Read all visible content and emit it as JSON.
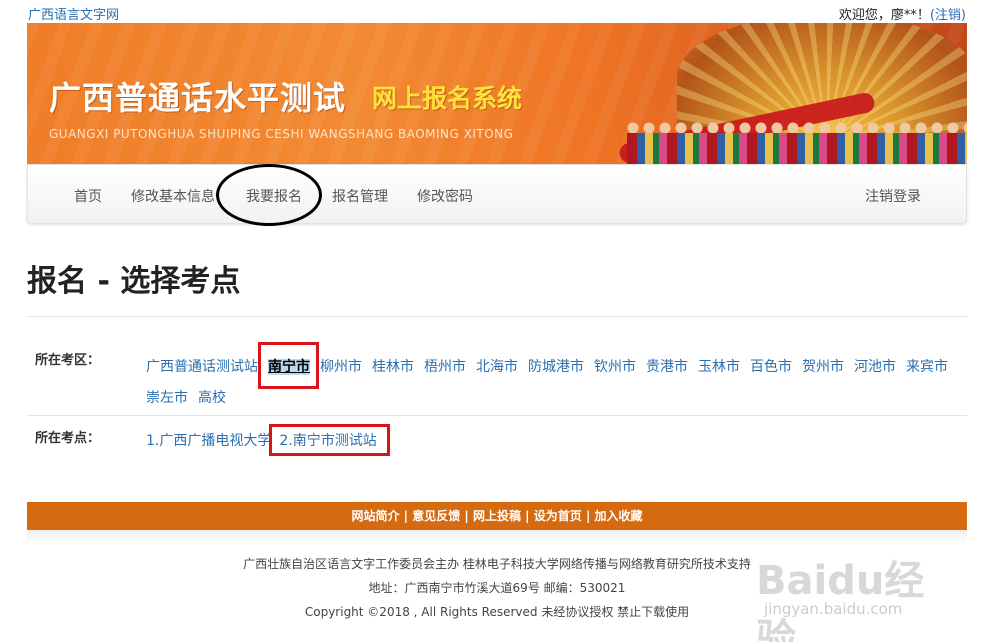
{
  "topbar": {
    "site_link": "广西语言文字网",
    "welcome": "欢迎您，廖**！",
    "logout_link": "(注销)"
  },
  "banner": {
    "title": "广西普通话水平测试",
    "subtitle": "网上报名系统",
    "pinyin": "GUANGXI PUTONGHUA SHUIPING CESHI WANGSHANG BAOMING XITONG"
  },
  "nav": {
    "items": [
      "首页",
      "修改基本信息",
      "我要报名",
      "报名管理",
      "修改密码"
    ],
    "right": "注销登录"
  },
  "page": {
    "title": "报名 - 选择考点"
  },
  "district": {
    "label": "所在考区：",
    "options": [
      "广西普通话测试站",
      "南宁市",
      "柳州市",
      "桂林市",
      "梧州市",
      "北海市",
      "防城港市",
      "钦州市",
      "贵港市",
      "玉林市",
      "百色市",
      "贺州市",
      "河池市",
      "来宾市",
      "崇左市",
      "高校"
    ],
    "selected": "南宁市"
  },
  "site": {
    "label": "所在考点：",
    "options": [
      "1.广西广播电视大学",
      "2.南宁市测试站"
    ]
  },
  "footer": {
    "links": [
      "网站简介",
      "意见反馈",
      "网上投稿",
      "设为首页",
      "加入收藏"
    ],
    "separator": " | ",
    "sponsor": "广西壮族自治区语言文字工作委员会主办 桂林电子科技大学网络传播与网络教育研究所技术支持",
    "address": "地址：广西南宁市竹溪大道69号 邮编：530021",
    "copyright": "Copyright ©2018 , All Rights Reserved 未经协议授权 禁止下载使用"
  },
  "watermark": {
    "main": "Baidu经验",
    "sub": "jingyan.baidu.com"
  },
  "colors": {
    "link": "#2a6fb0",
    "banner_orange": "#f07d28",
    "footer_orange": "#d66a10",
    "annotation_red": "#d8141b"
  }
}
